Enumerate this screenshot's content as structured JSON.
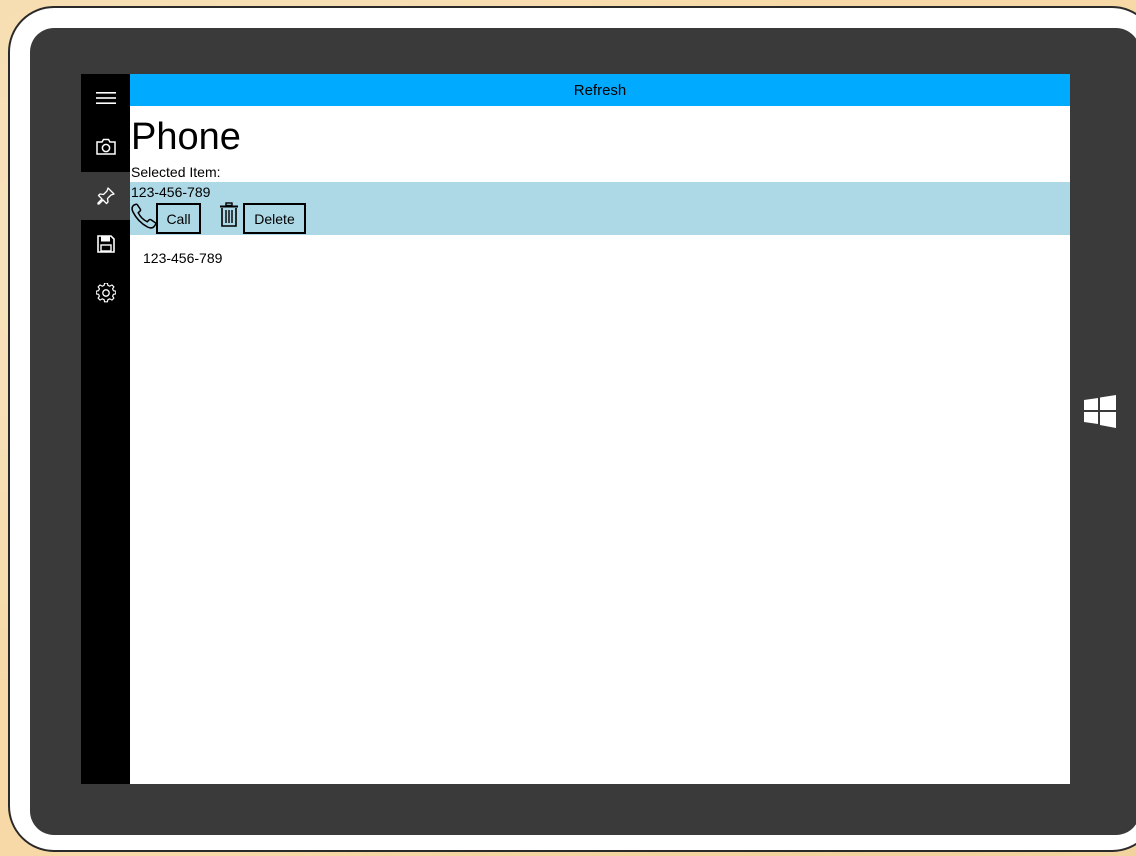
{
  "device": {
    "logo_icon": "windows-logo-icon"
  },
  "rail": {
    "items": [
      {
        "icon": "hamburger-menu-icon",
        "active": false
      },
      {
        "icon": "camera-icon",
        "active": false
      },
      {
        "icon": "pin-icon",
        "active": true
      },
      {
        "icon": "save-icon",
        "active": false
      },
      {
        "icon": "gear-icon",
        "active": false
      }
    ]
  },
  "header": {
    "refresh_label": "Refresh",
    "accent_color": "#00aaff"
  },
  "page": {
    "title": "Phone",
    "selected_label": "Selected Item:"
  },
  "selected": {
    "number": "123-456-789",
    "row_color": "#add8e6",
    "call_icon": "phone-icon",
    "call_label": "Call",
    "delete_icon": "trash-icon",
    "delete_label": "Delete"
  },
  "list": {
    "items": [
      {
        "number": "123-456-789"
      }
    ]
  }
}
